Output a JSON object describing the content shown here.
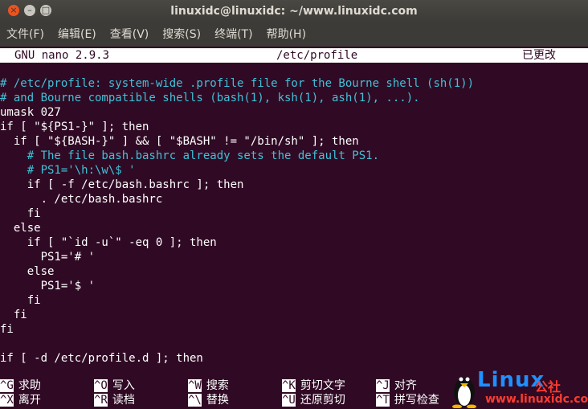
{
  "window": {
    "title": "linuxidc@linuxidc: ~/www.linuxidc.com",
    "buttons": [
      "×",
      "–",
      "□"
    ]
  },
  "menu": [
    "文件(F)",
    "编辑(E)",
    "查看(V)",
    "搜索(S)",
    "终端(T)",
    "帮助(H)"
  ],
  "nano": {
    "version": "GNU nano 2.9.3",
    "file": "/etc/profile",
    "state": "已更改"
  },
  "code": [
    {
      "t": "# /etc/profile: system-wide .profile file for the Bourne shell (sh(1))",
      "c": true
    },
    {
      "t": "# and Bourne compatible shells (bash(1), ksh(1), ash(1), ...).",
      "c": true
    },
    {
      "t": "umask 027",
      "c": false
    },
    {
      "t": "if [ \"${PS1-}\" ]; then",
      "c": false
    },
    {
      "t": "  if [ \"${BASH-}\" ] && [ \"$BASH\" != \"/bin/sh\" ]; then",
      "c": false
    },
    {
      "t": "    # The file bash.bashrc already sets the default PS1.",
      "c": true
    },
    {
      "t": "    # PS1='\\h:\\w\\$ '",
      "c": true
    },
    {
      "t": "    if [ -f /etc/bash.bashrc ]; then",
      "c": false
    },
    {
      "t": "      . /etc/bash.bashrc",
      "c": false
    },
    {
      "t": "    fi",
      "c": false
    },
    {
      "t": "  else",
      "c": false
    },
    {
      "t": "    if [ \"`id -u`\" -eq 0 ]; then",
      "c": false
    },
    {
      "t": "      PS1='# '",
      "c": false
    },
    {
      "t": "    else",
      "c": false
    },
    {
      "t": "      PS1='$ '",
      "c": false
    },
    {
      "t": "    fi",
      "c": false
    },
    {
      "t": "  fi",
      "c": false
    },
    {
      "t": "fi",
      "c": false
    },
    {
      "t": "",
      "c": false
    },
    {
      "t": "if [ -d /etc/profile.d ]; then",
      "c": false
    }
  ],
  "help": [
    [
      {
        "key": "^G",
        "label": "求助"
      },
      {
        "key": "^O",
        "label": "写入"
      },
      {
        "key": "^W",
        "label": "搜索"
      },
      {
        "key": "^K",
        "label": "剪切文字"
      },
      {
        "key": "^J",
        "label": "对齐"
      }
    ],
    [
      {
        "key": "^X",
        "label": "离开"
      },
      {
        "key": "^R",
        "label": "读档"
      },
      {
        "key": "^\\",
        "label": "替换"
      },
      {
        "key": "^U",
        "label": "还原剪切"
      },
      {
        "key": "^T",
        "label": "拼写检查"
      }
    ]
  ],
  "watermark": {
    "brand": "Linux",
    "suffix": "公社",
    "url": "www.linuxidc.com"
  }
}
